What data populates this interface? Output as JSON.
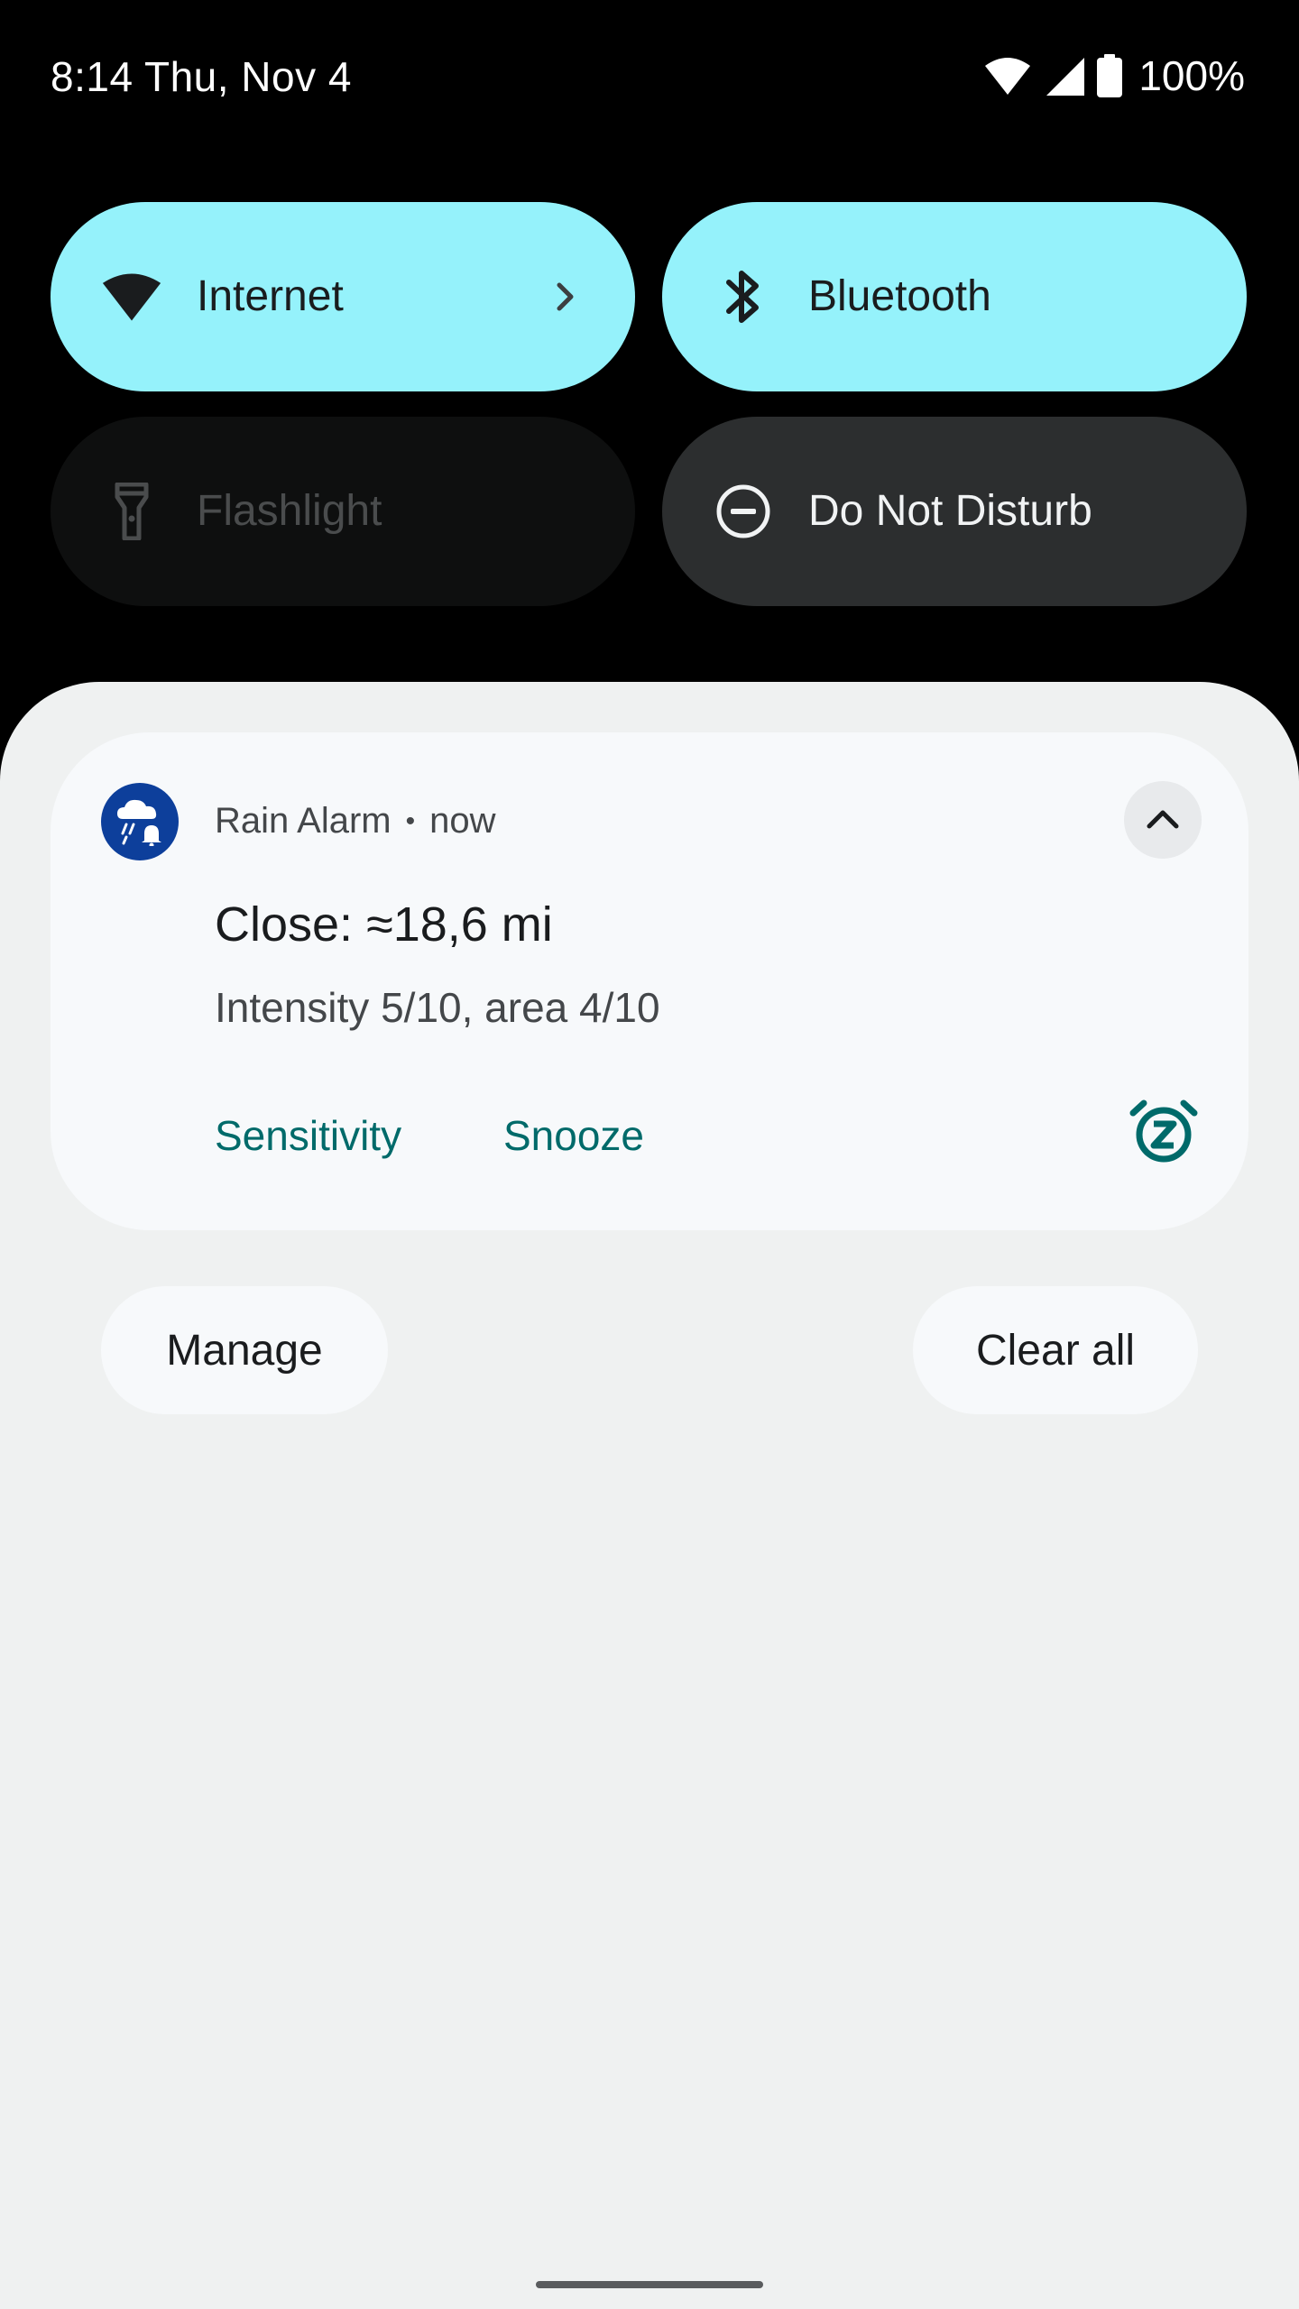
{
  "status_bar": {
    "time": "8:14 Thu, Nov 4",
    "battery": "100%",
    "icons": [
      "wifi-icon",
      "cell-signal-icon",
      "battery-icon"
    ]
  },
  "quick_settings": {
    "tiles": [
      {
        "label": "Internet",
        "icon": "wifi-icon",
        "state": "on",
        "has_chevron": true
      },
      {
        "label": "Bluetooth",
        "icon": "bluetooth-icon",
        "state": "on"
      },
      {
        "label": "Flashlight",
        "icon": "flashlight-icon",
        "state": "unavailable"
      },
      {
        "label": "Do Not Disturb",
        "icon": "do-not-disturb-icon",
        "state": "off"
      }
    ]
  },
  "notification": {
    "app_name": "Rain Alarm",
    "separator": "•",
    "time": "now",
    "title": "Close: ≈18,6 mi",
    "text": "Intensity 5/10, area 4/10",
    "actions": [
      "Sensitivity",
      "Snooze"
    ],
    "app_icon": "rain-alarm-icon",
    "app_icon_color": "#0d3f9b",
    "accent_color": "#006a6a"
  },
  "shade_buttons": {
    "manage": "Manage",
    "clear_all": "Clear all"
  },
  "colors": {
    "tile_active": "#95f2fb",
    "tile_inactive": "#2c2e2f",
    "shade_background": "#eff1f1",
    "card_background": "#f7f9fb"
  }
}
